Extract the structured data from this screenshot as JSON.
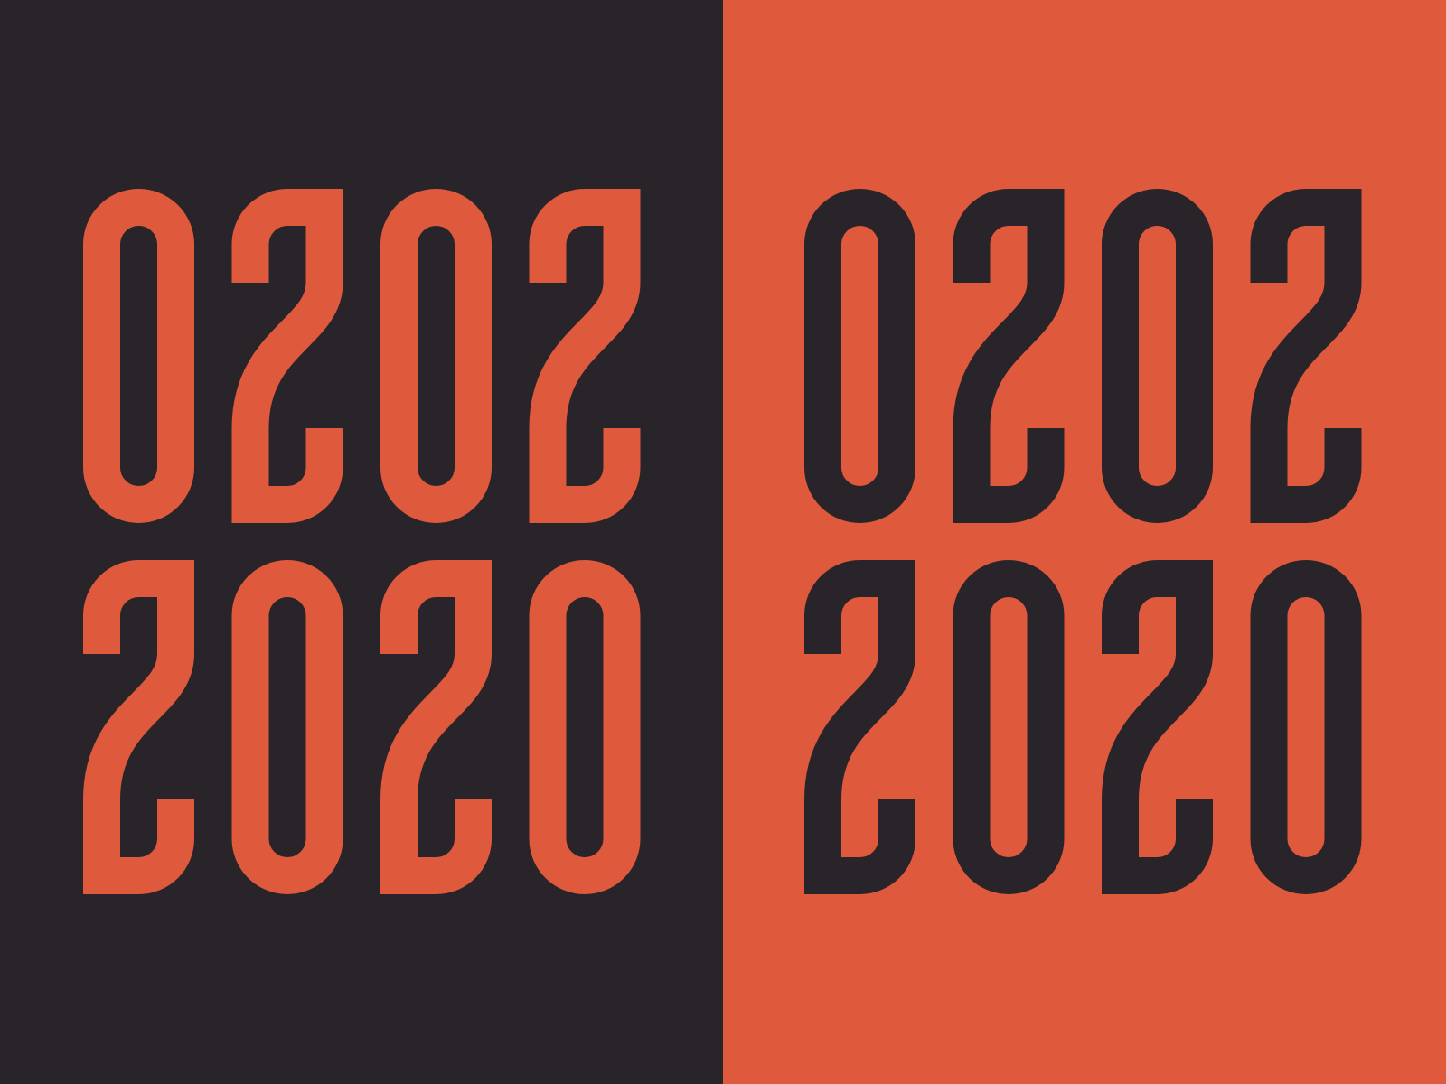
{
  "colors": {
    "dark": "#29242a",
    "orange": "#df5a3c"
  },
  "panels": [
    {
      "name": "dark",
      "background": "dark",
      "glyph_color": "orange",
      "rows": [
        "0202",
        "2020"
      ]
    },
    {
      "name": "orange",
      "background": "orange",
      "glyph_color": "dark",
      "rows": [
        "0202",
        "2020"
      ]
    }
  ]
}
